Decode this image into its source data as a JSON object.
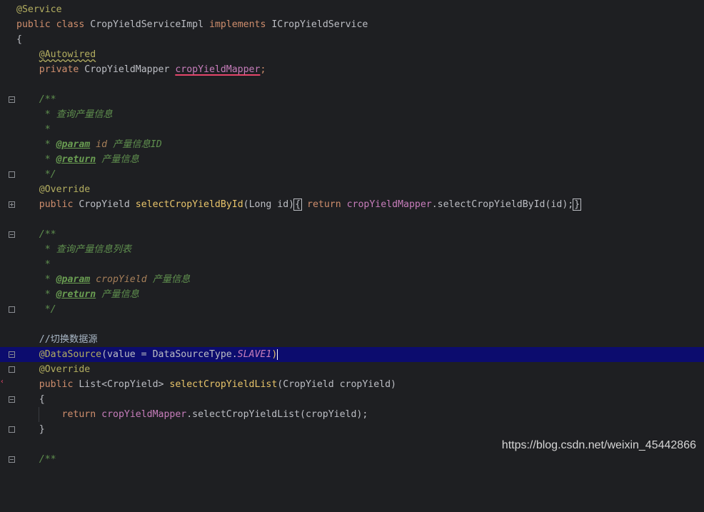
{
  "editor": {
    "watermark": "https://blog.csdn.net/weixin_45442866",
    "lines": {
      "l1": {
        "ann": "@Service"
      },
      "l2": {
        "kw1": "public",
        "kw2": "class",
        "cls": "CropYieldServiceImpl",
        "kw3": "implements",
        "iface": "ICropYieldService"
      },
      "l3": {
        "brace": "{"
      },
      "l4": {
        "ann": "@Autowired"
      },
      "l5": {
        "kw": "private",
        "type": "CropYieldMapper",
        "field": "cropYieldMapper",
        "semi": ";"
      },
      "l7": {
        "c": "/**"
      },
      "l8": {
        "c": " * 查询产量信息"
      },
      "l9": {
        "c": " *"
      },
      "l10": {
        "star": " * ",
        "tag": "@param",
        "param": " id",
        "desc": " 产量信息ID"
      },
      "l11": {
        "star": " * ",
        "tag": "@return",
        "desc": " 产量信息"
      },
      "l12": {
        "c": " */"
      },
      "l13": {
        "ann": "@Override"
      },
      "l14": {
        "kw": "public",
        "type": "CropYield",
        "fn": "selectCropYieldById",
        "args": "(Long id)",
        "ob": "{",
        "ret": "return",
        "field": "cropYieldMapper",
        "call": ".selectCropYieldById(id);",
        "cb": "}"
      },
      "l16": {
        "c": "/**"
      },
      "l17": {
        "c": " * 查询产量信息列表"
      },
      "l18": {
        "c": " *"
      },
      "l19": {
        "star": " * ",
        "tag": "@param",
        "param": " cropYield",
        "desc": " 产量信息"
      },
      "l20": {
        "star": " * ",
        "tag": "@return",
        "desc": " 产量信息"
      },
      "l21": {
        "c": " */"
      },
      "l23": {
        "c": "//切换数据源"
      },
      "l24": {
        "ann": "@DataSource",
        "open": "(value = DataSourceType.",
        "const": "SLAVE1",
        "close": ")"
      },
      "l25": {
        "ann": "@Override"
      },
      "l26": {
        "kw": "public",
        "type": "List<CropYield>",
        "fn": "selectCropYieldList",
        "args": "(CropYield cropYield)"
      },
      "l27": {
        "brace": "{"
      },
      "l28": {
        "ret": "return",
        "field": "cropYieldMapper",
        "call": ".selectCropYieldList(cropYield);"
      },
      "l29": {
        "brace": "}"
      },
      "l31": {
        "c": "/**"
      }
    }
  }
}
